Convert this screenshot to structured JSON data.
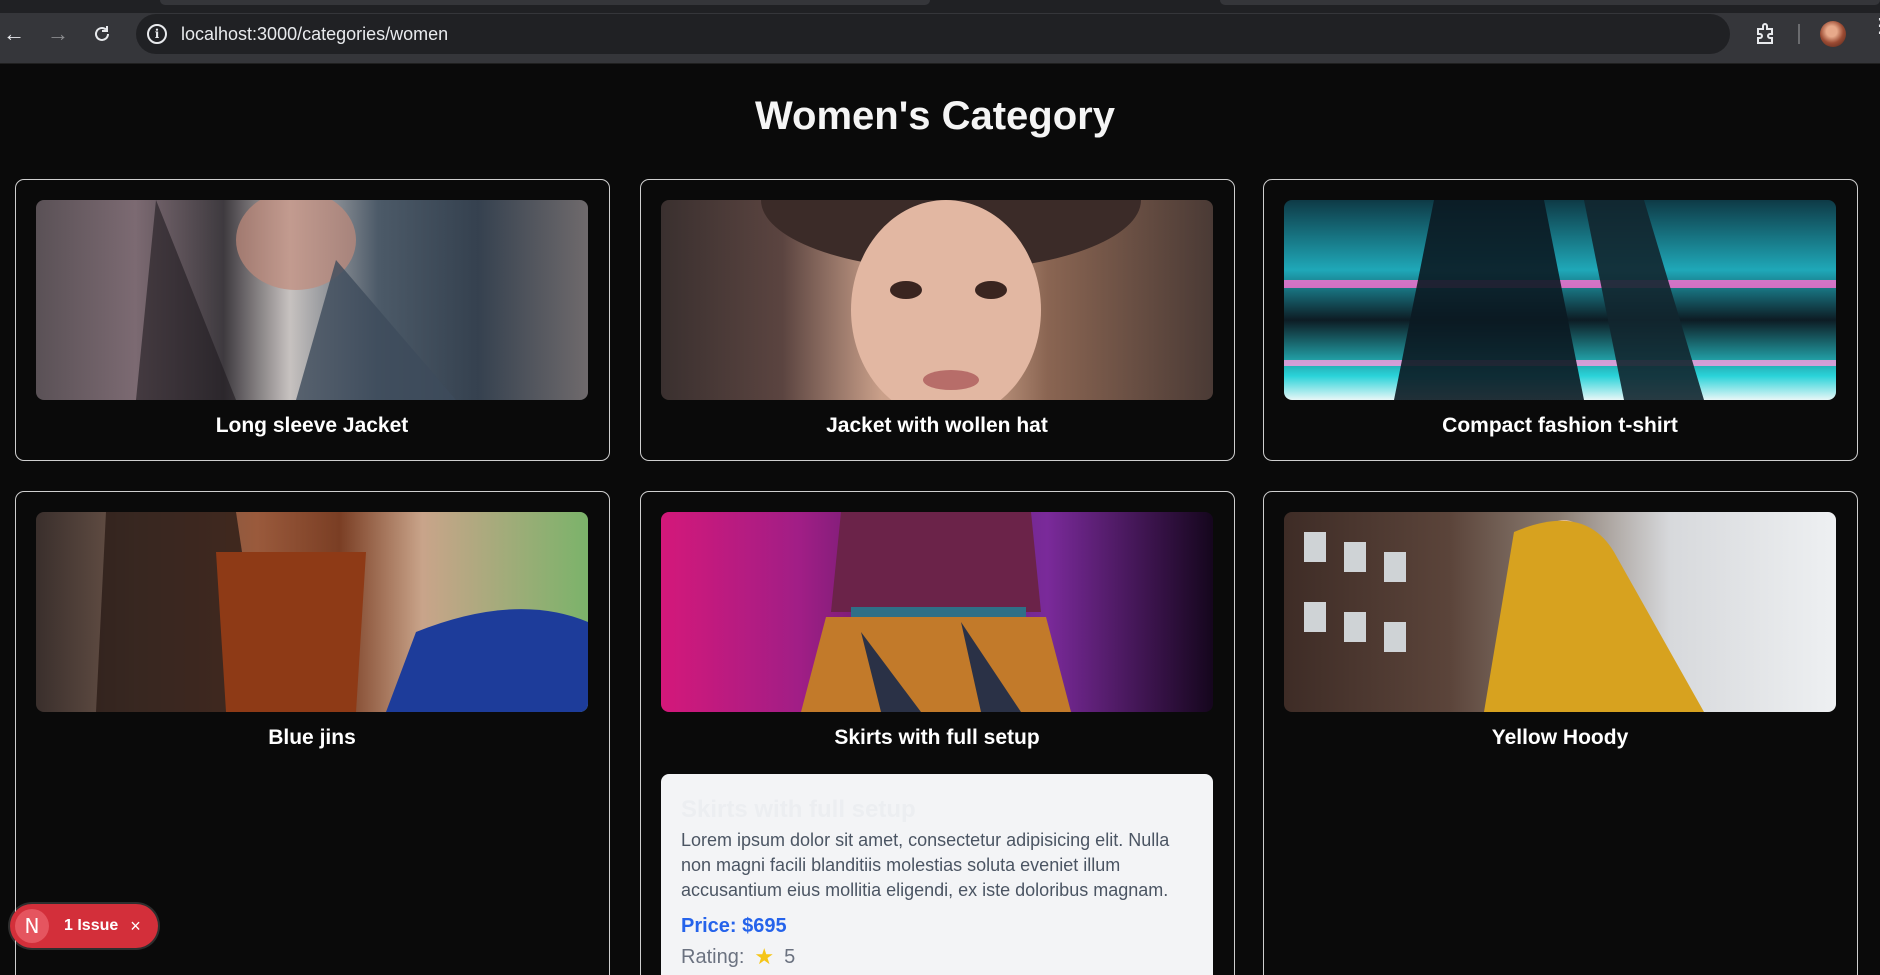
{
  "browser": {
    "url": "localhost:3000/categories/women"
  },
  "page": {
    "title": "Women's Category"
  },
  "products": [
    {
      "name": "Long sleeve Jacket",
      "image": "woman in denim jacket"
    },
    {
      "name": "Jacket with wollen hat",
      "image": "woman with fur hat"
    },
    {
      "name": "Compact fashion t-shirt",
      "image": "neon street scene"
    },
    {
      "name": "Blue jins",
      "image": "woman in blue jeans"
    },
    {
      "name": "Skirts with full setup",
      "image": "purple top with skirt"
    },
    {
      "name": "Yellow Hoody",
      "image": "man in yellow hoody"
    }
  ],
  "details": {
    "title": "Skirts with full setup",
    "description": "Lorem ipsum dolor sit amet, consectetur adipisicing elit. Nulla non magni facili blanditiis molestias soluta eveniet illum accusantium eius mollitia eligendi, ex iste doloribus magnam.",
    "price": "Price: $695",
    "rating_label": "Rating:",
    "rating_value": "5"
  },
  "issue_badge": {
    "logo": "N",
    "text": "1 Issue",
    "close": "×"
  },
  "colors": {
    "page_bg": "#0a0a0a",
    "price": "#2563eb",
    "badge": "#d32f3a",
    "star": "#f5c518"
  }
}
